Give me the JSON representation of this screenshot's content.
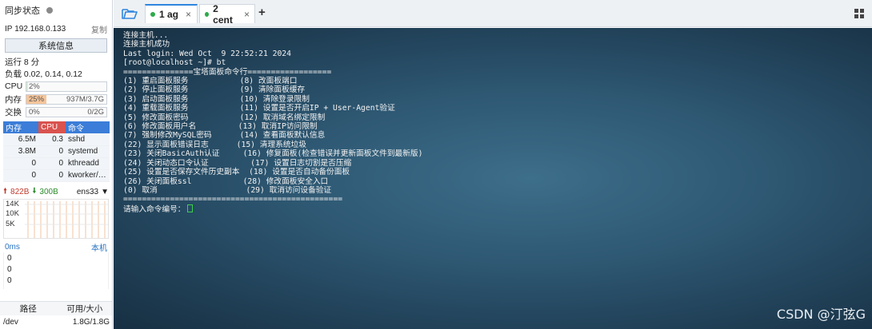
{
  "sidebar": {
    "sync_label": "同步状态",
    "ip_label": "IP",
    "ip_value": "192.168.0.133",
    "copy_label": "复制",
    "sysinfo_label": "系统信息",
    "uptime": "运行 8 分",
    "load": "负载 0.02, 0.14, 0.12",
    "cpu": {
      "label": "CPU",
      "pct": "2%",
      "fill": 0.02,
      "color": "#d7ebd3"
    },
    "mem": {
      "label": "内存",
      "pct": "25%",
      "amount": "937M/3.7G",
      "fill": 0.25,
      "color": "#f6c59a"
    },
    "swap": {
      "label": "交换",
      "pct": "0%",
      "amount": "0/2G",
      "fill": 0.0,
      "color": "#d7ebd3"
    },
    "proc_headers": [
      "内存",
      "CPU",
      "命令"
    ],
    "proc_header_colors": [
      "#3b7dd8",
      "#d9534f",
      "#3b7dd8"
    ],
    "processes": [
      {
        "mem": "6.5M",
        "cpu": "0.3",
        "cmd": "sshd"
      },
      {
        "mem": "3.8M",
        "cpu": "0",
        "cmd": "systemd"
      },
      {
        "mem": "0",
        "cpu": "0",
        "cmd": "kthreadd"
      },
      {
        "mem": "0",
        "cpu": "0",
        "cmd": "kworker/…"
      }
    ],
    "net": {
      "up": "822B",
      "down": "300B",
      "iface": "ens33",
      "yticks": [
        "14K",
        "10K",
        "5K"
      ]
    },
    "latency": {
      "label": "0ms",
      "host": "本机",
      "values": [
        "0",
        "0",
        "0"
      ]
    },
    "disk": {
      "headers": [
        "路径",
        "可用/大小"
      ],
      "path": "/dev",
      "size": "1.8G/1.8G"
    }
  },
  "tabs": [
    {
      "label": "1 ag",
      "close": "×",
      "active": true
    },
    {
      "label": "2 cent",
      "close": "×",
      "active": false
    }
  ],
  "add_tab": "+",
  "terminal": {
    "lines": [
      "连接主机...",
      "连接主机成功",
      "Last login: Wed Oct  9 22:52:21 2024",
      "[root@localhost ~]# bt",
      "===============宝塔面板命令行==================",
      "(1) 重启面板服务           (8) 改面板端口",
      "(2) 停止面板服务           (9) 清除面板缓存",
      "(3) 启动面板服务           (10) 清除登录限制",
      "(4) 重载面板服务           (11) 设置是否开启IP + User-Agent验证",
      "(5) 修改面板密码           (12) 取消域名绑定限制",
      "(6) 修改面板用户名         (13) 取消IP访问限制",
      "(7) 强制修改MySQL密码      (14) 查看面板默认信息",
      "(22) 显示面板错误日志      (15) 清理系统垃圾",
      "(23) 关闭BasicAuth认证     (16) 修复面板(检查错误并更新面板文件到最新版)",
      "(24) 关闭动态口令认证         (17) 设置日志切割是否压缩",
      "(25) 设置是否保存文件历史副本  (18) 设置是否自动备份面板",
      "(26) 关闭面板ssl           (28) 修改面板安全入口",
      "(0) 取消                   (29) 取消访问设备验证",
      "==============================================="
    ],
    "prompt": "请输入命令编号：",
    "watermark": "CSDN @汀弦G"
  }
}
